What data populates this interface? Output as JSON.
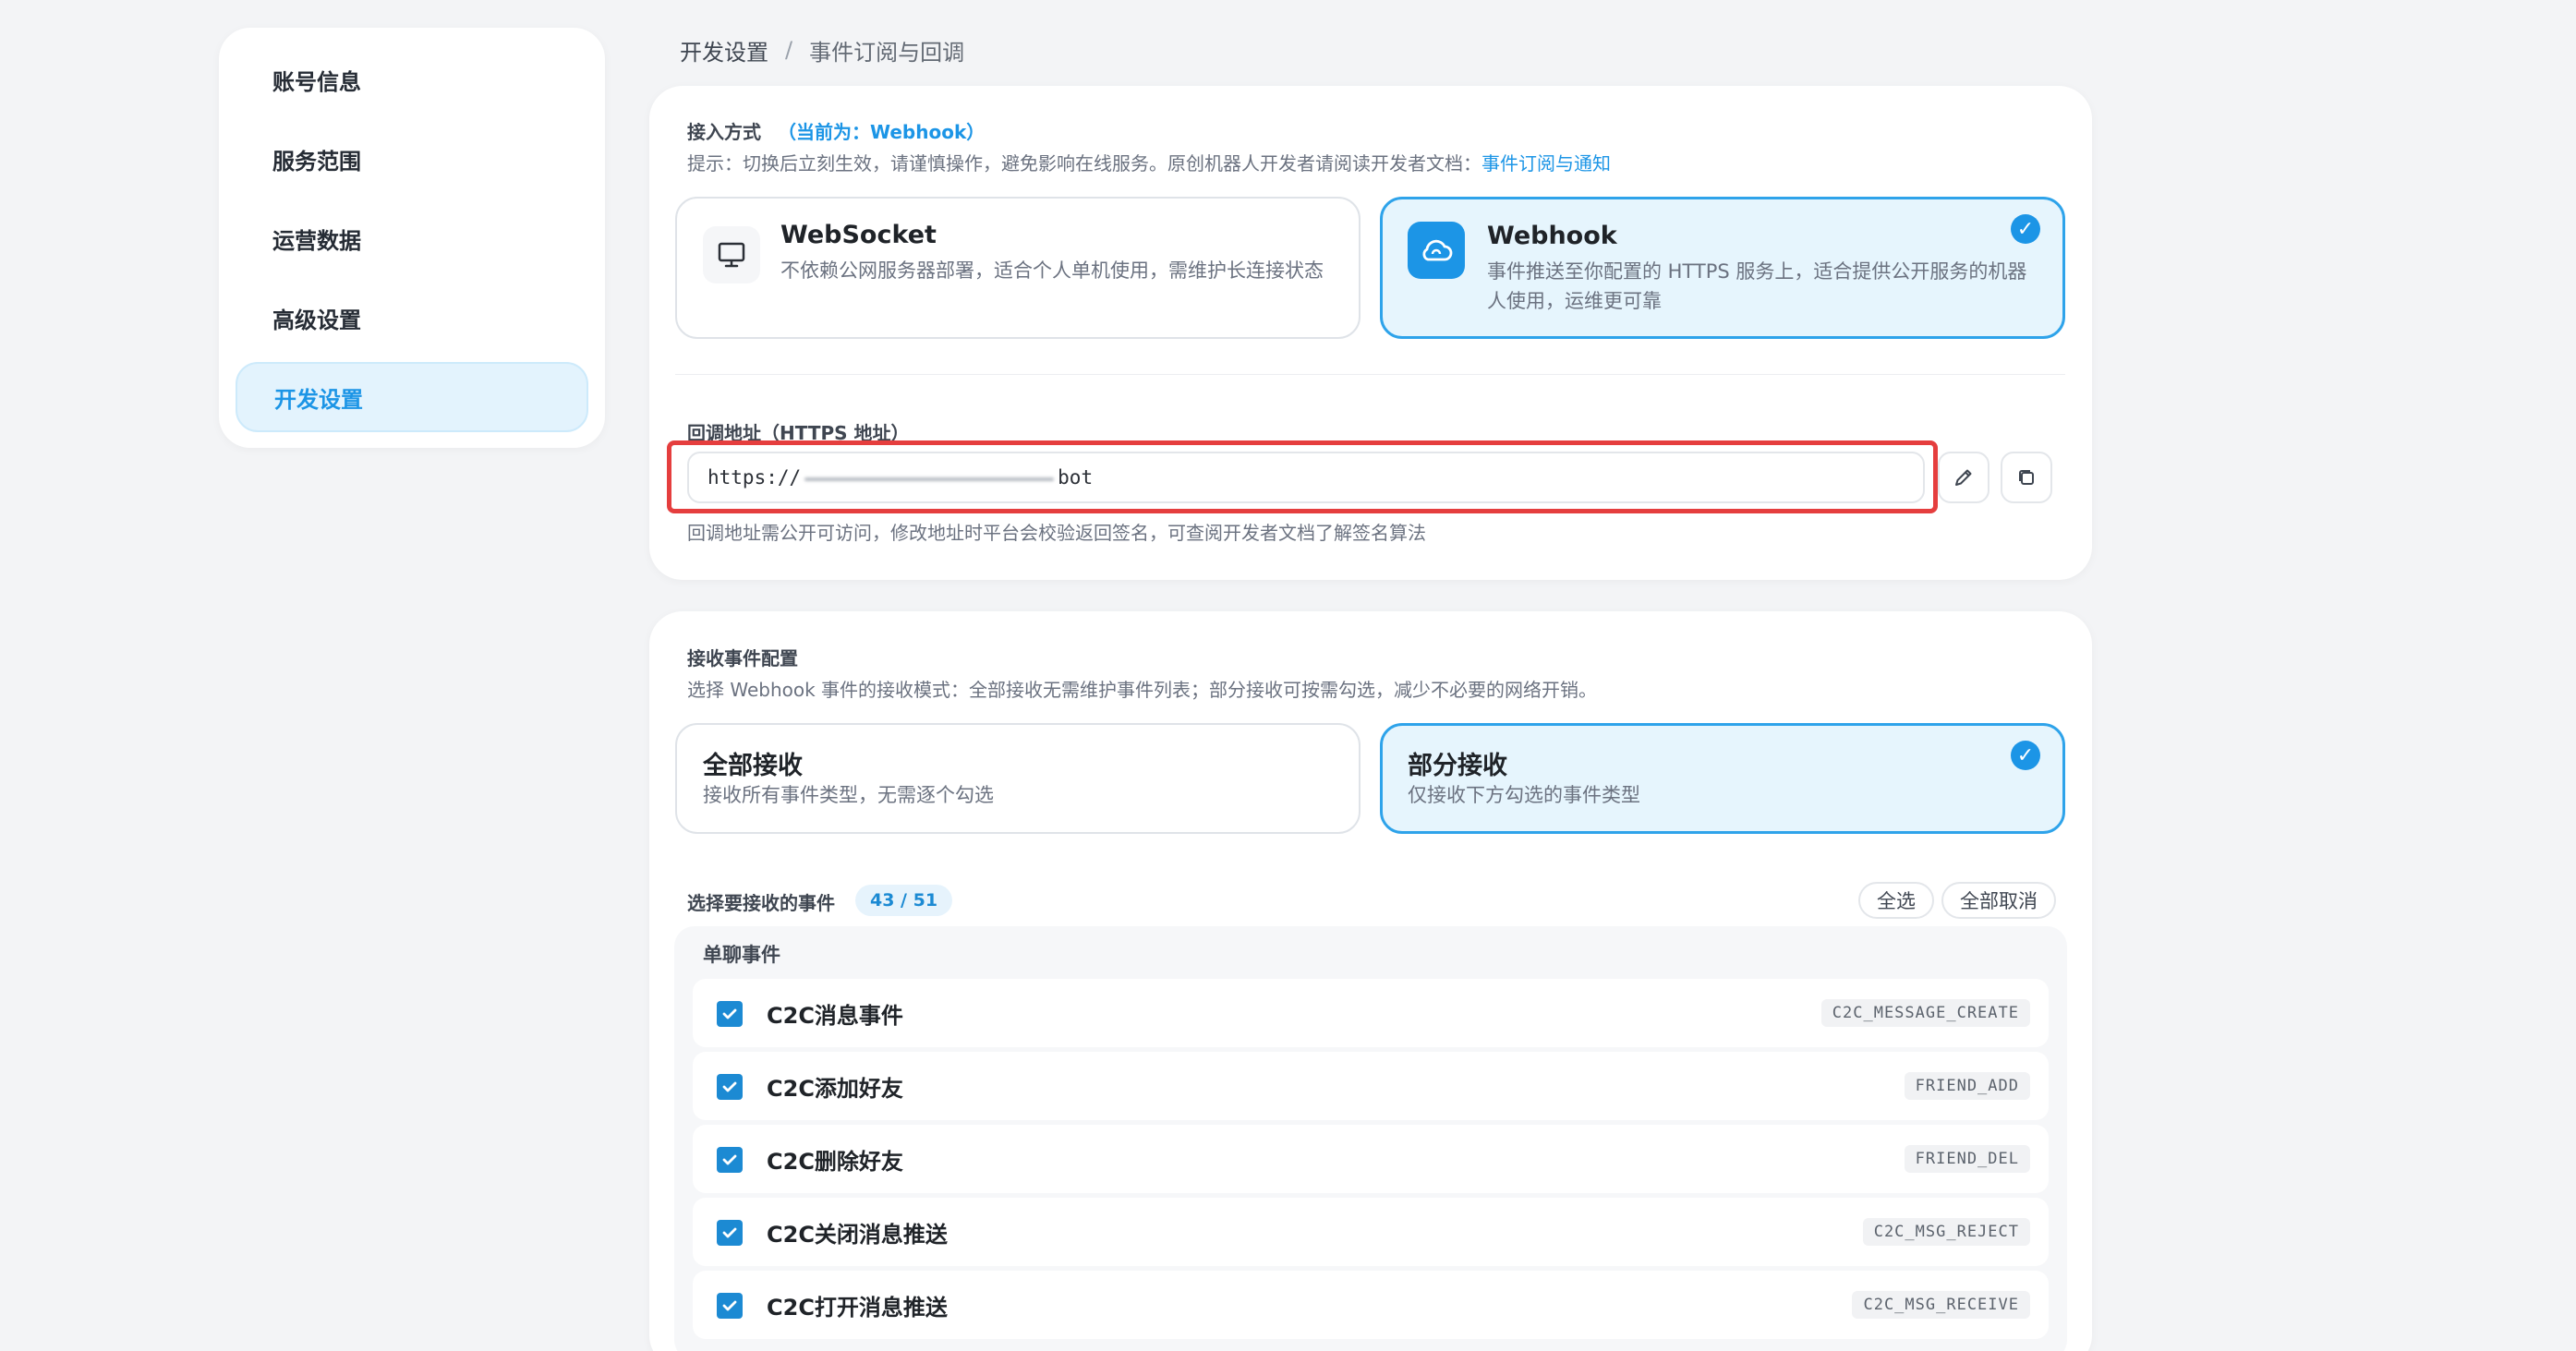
{
  "sidebar": {
    "items": [
      {
        "label": "账号信息"
      },
      {
        "label": "服务范围"
      },
      {
        "label": "运营数据"
      },
      {
        "label": "高级设置"
      },
      {
        "label": "开发设置"
      }
    ]
  },
  "breadcrumb": {
    "parent": "开发设置",
    "separator": "/",
    "current": "事件订阅与回调"
  },
  "access": {
    "title": "接入方式",
    "current_mode": "（当前为：Webhook）",
    "hint": "提示：切换后立刻生效，请谨慎操作，避免影响在线服务。原创机器人开发者请阅读开发者文档：",
    "hint_link": "事件订阅与通知",
    "options": [
      {
        "title": "WebSocket",
        "desc": "不依赖公网服务器部署，适合个人单机使用，需维护长连接状态",
        "icon": "monitor-icon",
        "selected": false
      },
      {
        "title": "Webhook",
        "desc": "事件推送至你配置的 HTTPS 服务上，适合提供公开服务的机器人使用，运维更可靠",
        "icon": "cloud-icon",
        "selected": true
      }
    ]
  },
  "callback": {
    "label": "回调地址（HTTPS 地址）",
    "url_prefix": "https://",
    "url_suffix": "bot",
    "note": "回调地址需公开可访问，修改地址时平台会校验返回签名，可查阅开发者文档了解签名算法"
  },
  "events_config": {
    "title": "接收事件配置",
    "hint": "选择 Webhook 事件的接收模式：全部接收无需维护事件列表；部分接收可按需勾选，减少不必要的网络开销。",
    "modes": [
      {
        "title": "全部接收",
        "desc": "接收所有事件类型，无需逐个勾选",
        "selected": false
      },
      {
        "title": "部分接收",
        "desc": "仅接收下方勾选的事件类型",
        "selected": true
      }
    ],
    "select_label": "选择要接收的事件",
    "count": "43 / 51",
    "select_all": "全选",
    "deselect_all": "全部取消",
    "group_title": "单聊事件",
    "events": [
      {
        "name": "C2C消息事件",
        "code": "C2C_MESSAGE_CREATE",
        "checked": true
      },
      {
        "name": "C2C添加好友",
        "code": "FRIEND_ADD",
        "checked": true
      },
      {
        "name": "C2C删除好友",
        "code": "FRIEND_DEL",
        "checked": true
      },
      {
        "name": "C2C关闭消息推送",
        "code": "C2C_MSG_REJECT",
        "checked": true
      },
      {
        "name": "C2C打开消息推送",
        "code": "C2C_MSG_RECEIVE",
        "checked": true
      }
    ]
  },
  "colors": {
    "accent": "#1c95e6",
    "highlight": "#e53e3e"
  }
}
